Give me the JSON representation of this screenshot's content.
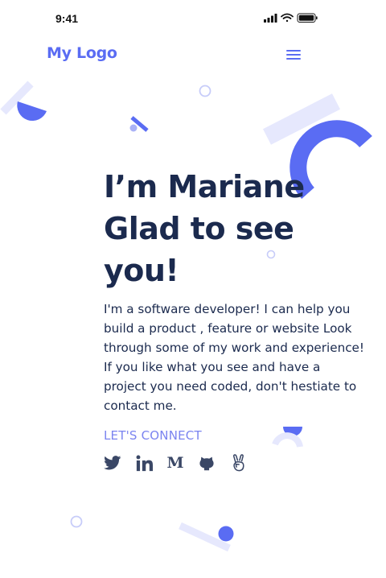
{
  "status_bar": {
    "time": "9:41",
    "icons": [
      "signal-icon",
      "wifi-icon",
      "battery-icon"
    ]
  },
  "header": {
    "logo": "My Logo",
    "menu_icon": "hamburger-menu-icon"
  },
  "hero": {
    "headline_lines": [
      "I’m Mariane",
      "Glad to see",
      "you!"
    ],
    "intro": "I'm a software developer! I can help you build a product , feature or website Look through some of my work and experience! If you like what you see and have a project you need coded, don't hestiate to contact me."
  },
  "connect": {
    "label": "LET'S CONNECT",
    "links": [
      {
        "icon": "twitter-icon"
      },
      {
        "icon": "linkedin-icon"
      },
      {
        "icon": "medium-icon",
        "text": "M"
      },
      {
        "icon": "github-icon"
      },
      {
        "icon": "angellist-icon"
      }
    ]
  },
  "colors": {
    "accent": "#5a6cf3",
    "accent_light": "#e6e8fd",
    "text": "#1b2a4e",
    "connect_label": "#7b84f0",
    "social_icon": "#3a4766"
  }
}
